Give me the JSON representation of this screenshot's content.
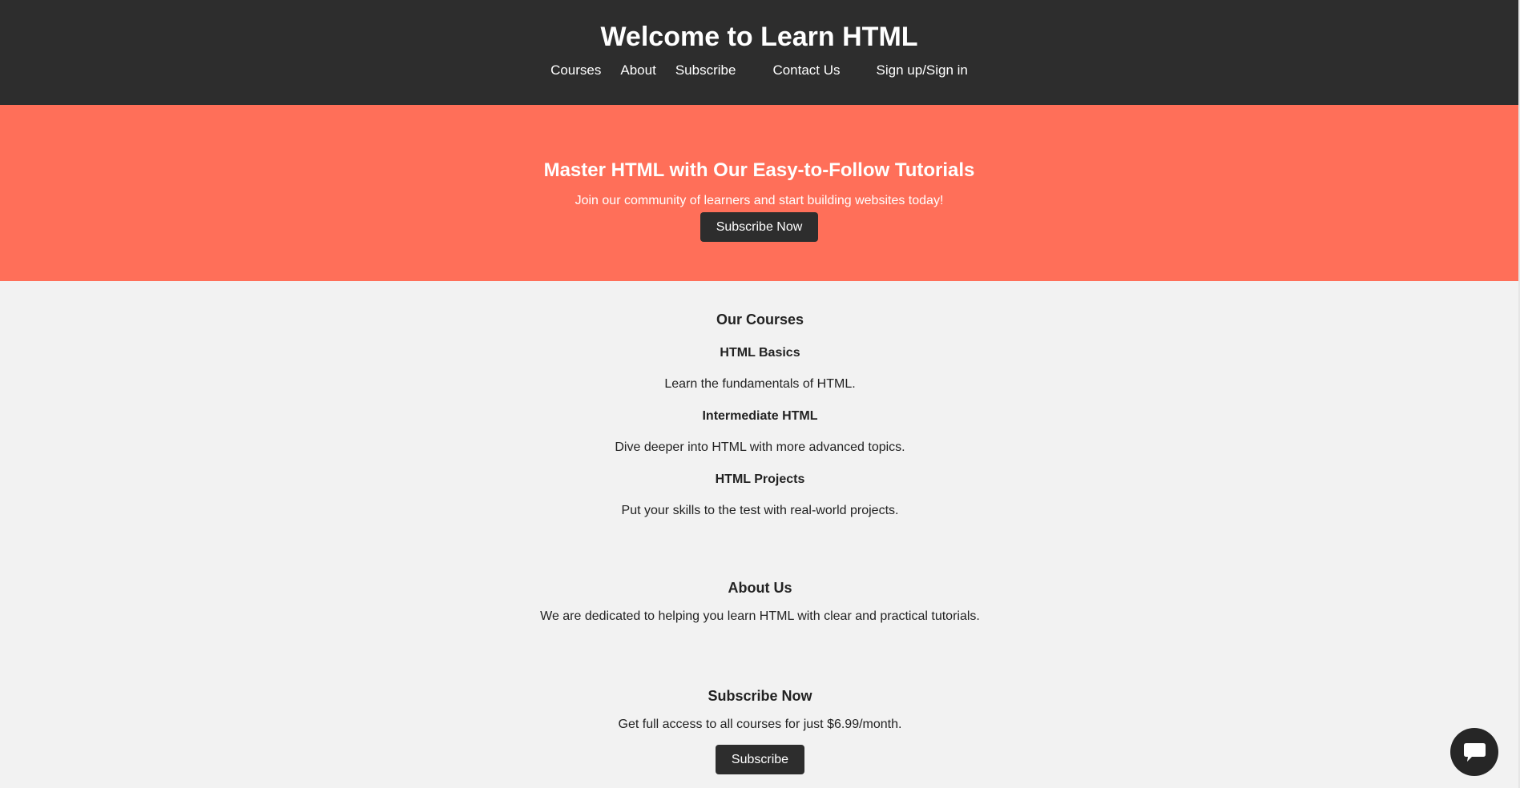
{
  "header": {
    "title": "Welcome to Learn HTML",
    "nav": [
      "Courses",
      "About",
      "Subscribe",
      "Contact Us",
      "Sign up/Sign in"
    ]
  },
  "hero": {
    "title": "Master HTML with Our Easy-to-Follow Tutorials",
    "subtitle": "Join our community of learners and start building websites today!",
    "button": "Subscribe Now"
  },
  "courses": {
    "heading": "Our Courses",
    "items": [
      {
        "name": "HTML Basics",
        "desc": "Learn the fundamentals of HTML."
      },
      {
        "name": "Intermediate HTML",
        "desc": "Dive deeper into HTML with more advanced topics."
      },
      {
        "name": "HTML Projects",
        "desc": "Put your skills to the test with real-world projects."
      }
    ]
  },
  "about": {
    "heading": "About Us",
    "text": "We are dedicated to helping you learn HTML with clear and practical tutorials."
  },
  "subscribe": {
    "heading": "Subscribe Now",
    "text": "Get full access to all courses for just $6.99/month.",
    "button": "Subscribe"
  },
  "chat": {
    "icon": "chat-bubble-icon"
  },
  "colors": {
    "header_bg": "#2d2d2d",
    "hero_bg": "#ff6f59",
    "page_bg": "#f2f2f2",
    "button_bg": "#2d2d2d"
  }
}
